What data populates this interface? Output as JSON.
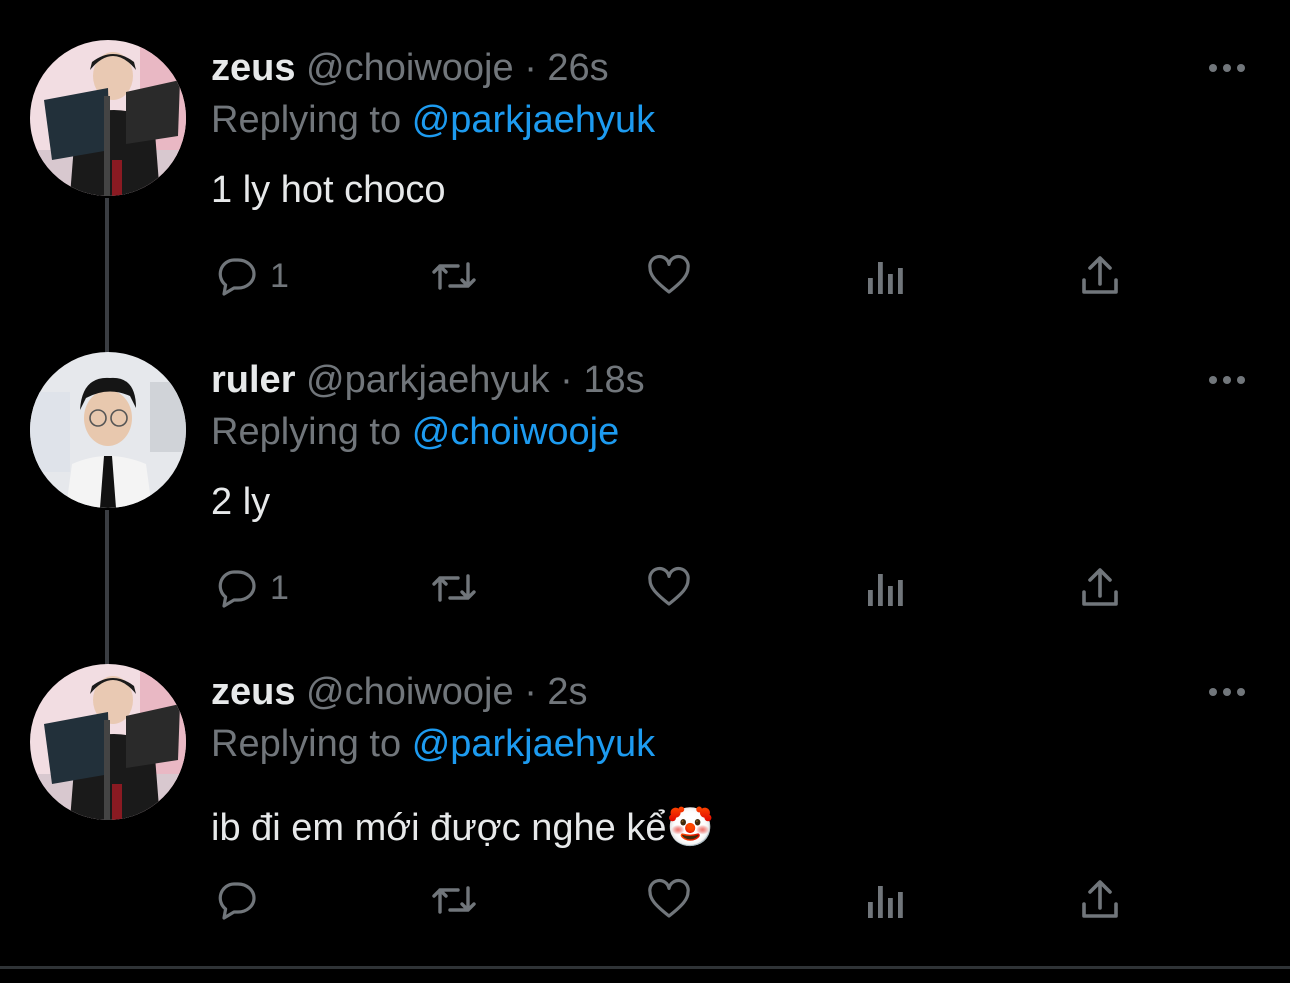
{
  "tweets": [
    {
      "display_name": "zeus",
      "handle": "@choiwooje",
      "separator": "·",
      "timestamp": "26s",
      "replying_prefix": "Replying to",
      "replying_to": "@parkjaehyuk",
      "text": "1 ly hot choco",
      "reply_count": "1"
    },
    {
      "display_name": "ruler",
      "handle": "@parkjaehyuk",
      "separator": "·",
      "timestamp": "18s",
      "replying_prefix": "Replying to",
      "replying_to": "@choiwooje",
      "text": "2 ly",
      "reply_count": "1"
    },
    {
      "display_name": "zeus",
      "handle": "@choiwooje",
      "separator": "·",
      "timestamp": "2s",
      "replying_prefix": "Replying to",
      "replying_to": "@parkjaehyuk",
      "text": "ib đi em mới được nghe kể🤡",
      "reply_count": ""
    }
  ],
  "icons": {
    "reply": "reply-icon",
    "retweet": "retweet-icon",
    "like": "like-icon",
    "views": "views-icon",
    "share": "share-icon",
    "more": "more-icon"
  },
  "colors": {
    "background": "#000000",
    "text": "#e7e9ea",
    "muted": "#71767b",
    "link": "#1d9bf0",
    "thread_line": "#3a3d42"
  }
}
